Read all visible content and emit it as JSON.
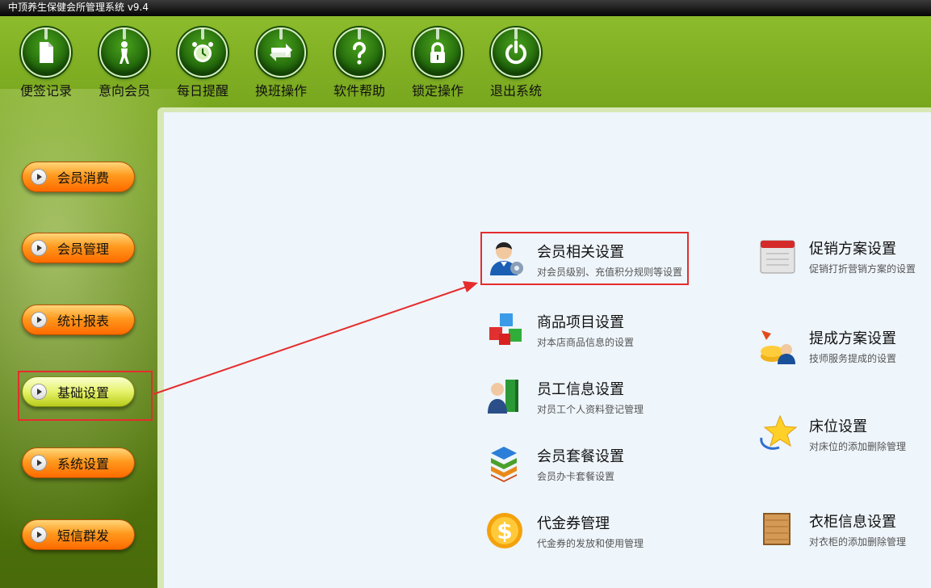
{
  "window": {
    "title": "中顶养生保健会所管理系统 v9.4"
  },
  "toolbar": [
    {
      "label": "便签记录",
      "icon": "note-icon"
    },
    {
      "label": "意向会员",
      "icon": "person-icon"
    },
    {
      "label": "每日提醒",
      "icon": "alarm-clock-icon"
    },
    {
      "label": "换班操作",
      "icon": "swap-arrows-icon"
    },
    {
      "label": "软件帮助",
      "icon": "help-question-icon"
    },
    {
      "label": "锁定操作",
      "icon": "lock-icon"
    },
    {
      "label": "退出系统",
      "icon": "power-icon"
    }
  ],
  "nav": [
    {
      "label": "会员消费"
    },
    {
      "label": "会员管理"
    },
    {
      "label": "统计报表"
    },
    {
      "label": "基础设置",
      "active": true
    },
    {
      "label": "系统设置"
    },
    {
      "label": "短信群发"
    }
  ],
  "settings": {
    "left": [
      {
        "title": "会员相关设置",
        "desc": "对会员级别、充值积分规则等设置",
        "icon": "member-settings-icon",
        "highlighted": true
      },
      {
        "title": "商品项目设置",
        "desc": "对本店商品信息的设置",
        "icon": "product-cubes-icon"
      },
      {
        "title": "员工信息设置",
        "desc": "对员工个人资料登记管理",
        "icon": "employee-icon"
      },
      {
        "title": "会员套餐设置",
        "desc": "会员办卡套餐设置",
        "icon": "package-stack-icon"
      },
      {
        "title": "代金券管理",
        "desc": "代金券的发放和使用管理",
        "icon": "coupon-dollar-icon"
      }
    ],
    "right": [
      {
        "title": "促销方案设置",
        "desc": "促销打折营销方案的设置",
        "icon": "promotion-calendar-icon"
      },
      {
        "title": "提成方案设置",
        "desc": "技师服务提成的设置",
        "icon": "commission-icon"
      },
      {
        "title": "床位设置",
        "desc": "对床位的添加删除管理",
        "icon": "bed-star-icon"
      },
      {
        "title": "衣柜信息设置",
        "desc": "对衣柜的添加删除管理",
        "icon": "wardrobe-icon"
      }
    ]
  },
  "colors": {
    "highlight": "#e52d2d",
    "nav_active": "#e5f26a",
    "nav_button": "#ff9a1e",
    "content_bg": "#eef5fb",
    "toolbar_green": "#2f7d10"
  }
}
